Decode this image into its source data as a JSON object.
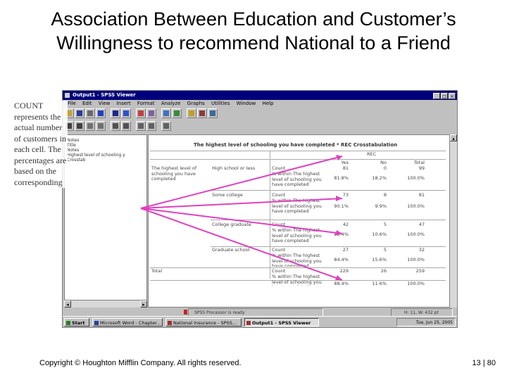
{
  "slide": {
    "title_line1": "Association Between Education and Customer’s",
    "title_line2": "Willingness to recommend National to a Friend",
    "callout": "COUNT represents the actual number of customers in each cell. The percentages are based on the corresponding",
    "copyright": "Copyright © Houghton Mifflin Company. All rights reserved.",
    "page_number": "13 | 80"
  },
  "window": {
    "title": "Output1 - SPSS Viewer",
    "menu": [
      "File",
      "Edit",
      "View",
      "Insert",
      "Format",
      "Analyze",
      "Graphs",
      "Utilities",
      "Window",
      "Help"
    ]
  },
  "outline": [
    "Notes",
    "Title",
    "Notes",
    "Highest level of schooling y",
    "Crosstab"
  ],
  "crosstab": {
    "title": "The highest level of schooling you have completed * REC Crosstabulation",
    "col_group": "REC",
    "col_headers": [
      "Yes",
      "No",
      "Total"
    ],
    "row_var": "The highest level of schooling you have completed",
    "rows": [
      {
        "group": "High school or less",
        "stat1": "Count",
        "stat2": "% within The highest level of schooling you have completed",
        "v1": [
          "81",
          "0",
          "99"
        ],
        "v2": [
          "81.8%",
          "18.2%",
          "100.0%"
        ]
      },
      {
        "group": "Some college",
        "stat1": "Count",
        "stat2": "% within The highest level of schooling you have completed",
        "v1": [
          "73",
          "8",
          "81"
        ],
        "v2": [
          "90.1%",
          "9.9%",
          "100.0%"
        ]
      },
      {
        "group": "College graduate",
        "stat1": "Count",
        "stat2": "% within The highest level of schooling you have completed",
        "v1": [
          "42",
          "5",
          "47"
        ],
        "v2": [
          "89.4%",
          "10.6%",
          "100.0%"
        ]
      },
      {
        "group": "Graduate school",
        "stat1": "Count",
        "stat2": "% within The highest level of schooling you have completed",
        "v1": [
          "27",
          "5",
          "32"
        ],
        "v2": [
          "84.4%",
          "15.6%",
          "100.0%"
        ]
      }
    ],
    "total": {
      "label": "Total",
      "stat1": "Count",
      "stat2": "% within The highest level of schooling you have completed",
      "v1": [
        "229",
        "26",
        "259"
      ],
      "v2": [
        "88.4%",
        "11.6%",
        "100.0%"
      ]
    }
  },
  "statusbar": {
    "processor": "SPSS Processor is ready",
    "info": "H: 11, W: 432 pt"
  },
  "taskbar": {
    "start": "Start",
    "tasks": [
      "Microsoft Word - Chapter...",
      "National Insurance - SPSS...",
      "Output1 - SPSS Viewer"
    ],
    "clock": "Tue, Jun 25, 2005"
  },
  "colors": {
    "titlebar": "#00007b",
    "arrow": "#e040c0",
    "face": "#c0c0c0"
  }
}
